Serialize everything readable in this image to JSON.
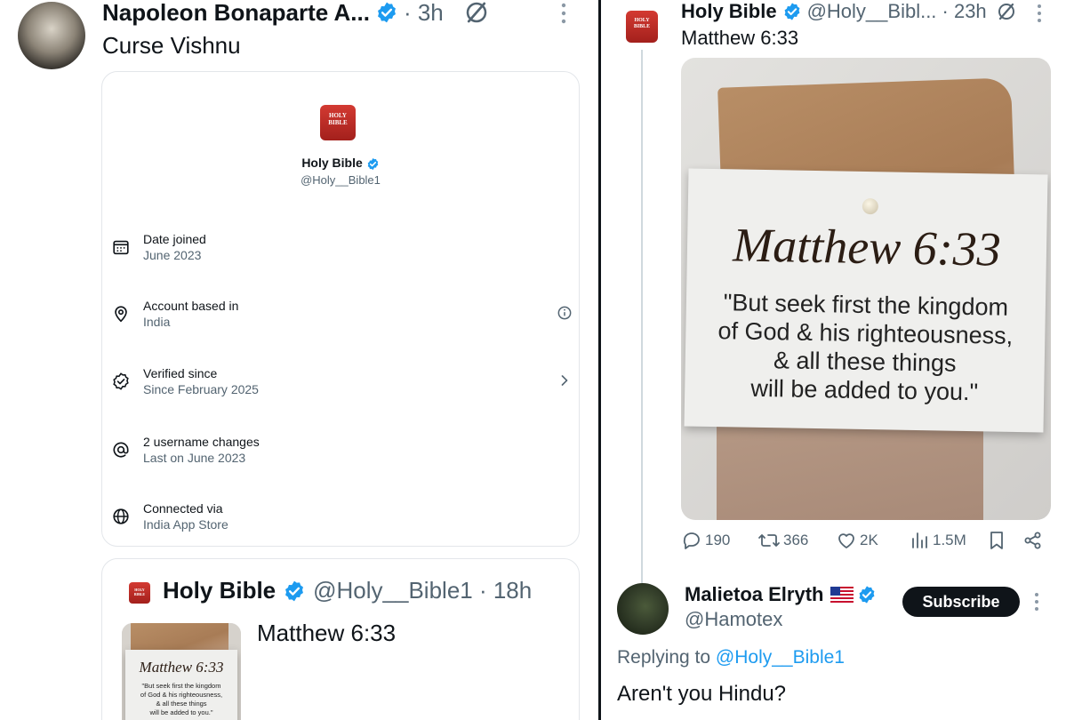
{
  "left_tweet": {
    "author_name": "Napoleon Bonaparte A...",
    "time": "· 3h",
    "text": "Curse Vishnu",
    "about_card": {
      "app_icon_text": "HOLY BIBLE",
      "name": "Holy Bible",
      "handle": "@Holy__Bible1",
      "rows": [
        {
          "icon": "calendar-icon",
          "label": "Date joined",
          "value": "June 2023"
        },
        {
          "icon": "location-pin-icon",
          "label": "Account based in",
          "value": "India",
          "trail_icon": "info-icon"
        },
        {
          "icon": "verified-badge-outline-icon",
          "label": "Verified since",
          "value": "Since February 2025",
          "trail_icon": "chevron-right-icon"
        },
        {
          "icon": "at-sign-icon",
          "label": "2 username changes",
          "value": "Last on June 2023"
        },
        {
          "icon": "globe-icon",
          "label": "Connected via",
          "value": "India App Store"
        }
      ]
    },
    "quoted_tweet": {
      "name": "Holy Bible",
      "handle": "@Holy__Bible1 · 18h",
      "text": "Matthew 6:33",
      "image_title": "Matthew 6:33",
      "image_quote": "\"But seek first the kingdom\nof God & his righteousness,\n& all these things\nwill be added to you.\""
    }
  },
  "right_tweet": {
    "app_icon_text": "HOLY BIBLE",
    "name": "Holy Bible",
    "handle": "@Holy__Bibl... · 23h",
    "text": "Matthew 6:33",
    "image_title": "Matthew 6:33",
    "image_quote": "\"But seek first the kingdom\nof God & his righteousness,\n& all these things\nwill be added to you.\"",
    "actions": {
      "replies": "190",
      "reposts": "366",
      "likes": "2K",
      "views": "1.5M"
    }
  },
  "reply": {
    "name": "Malietoa Elryth",
    "handle": "@Hamotex",
    "subscribe_label": "Subscribe",
    "replying_prefix": "Replying to",
    "replying_mention": "@Holy__Bible1",
    "text": "Aren't you Hindu?"
  },
  "colors": {
    "text": "#0f1419",
    "secondary": "#536471",
    "accent": "#1d9bf0",
    "verified": "#1d9bf0",
    "card_border": "#e3e6ea",
    "app_icon_red": "#c62f28"
  }
}
